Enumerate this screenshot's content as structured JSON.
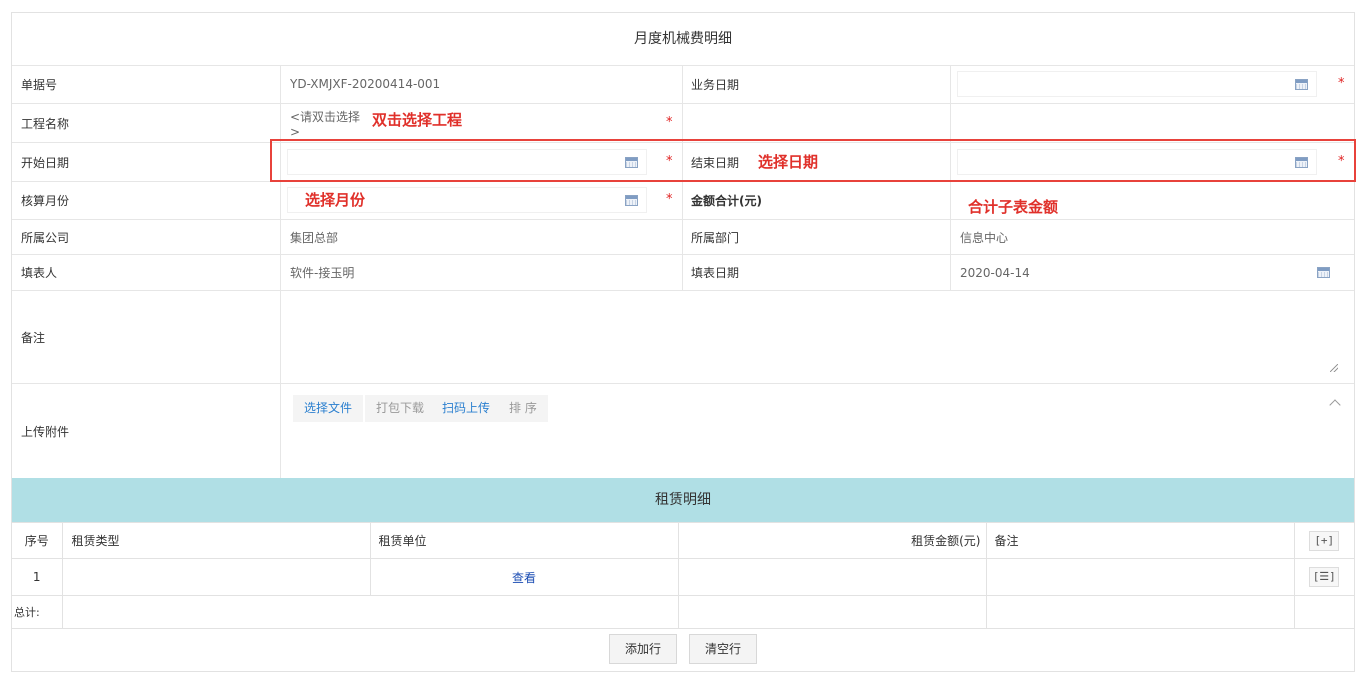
{
  "form": {
    "title": "月度机械费明细",
    "fields": {
      "doc_no_label": "单据号",
      "doc_no_value": "YD-XMJXF-20200414-001",
      "biz_date_label": "业务日期",
      "project_label": "工程名称",
      "project_placeholder": "<请双击选择>",
      "start_date_label": "开始日期",
      "end_date_label": "结束日期",
      "period_label": "核算月份",
      "amount_total_label": "金额合计(元)",
      "company_label": "所属公司",
      "company_value": "集团总部",
      "dept_label": "所属部门",
      "dept_value": "信息中心",
      "filler_label": "填表人",
      "filler_value": "软件-接玉明",
      "fill_date_label": "填表日期",
      "fill_date_value": "2020-04-14",
      "remark_label": "备注",
      "upload_label": "上传附件"
    },
    "required_mark": "*",
    "upload_buttons": [
      "选择文件",
      "打包下载",
      "扫码上传",
      "排 序"
    ]
  },
  "annotations": {
    "project_hint": "双击选择工程",
    "date_hint": "选择日期",
    "month_hint": "选择月份",
    "sum_hint": "合计子表金额"
  },
  "detail": {
    "title": "租赁明细",
    "headers": [
      "序号",
      "租赁类型",
      "租赁单位",
      "租赁金额(元)",
      "备注"
    ],
    "add_btn": "[+]",
    "rows": [
      {
        "no": "1",
        "type": "",
        "unit_link": "查看",
        "amount": "",
        "remark": "",
        "menu_btn": "[☰]"
      }
    ],
    "total_label": "总计:",
    "add_row_btn": "添加行",
    "clear_rows_btn": "清空行"
  },
  "colors": {
    "annotation_red": "#e0302a",
    "section_header_bg": "#b0dfe5",
    "link_blue": "#2a7fcf"
  }
}
